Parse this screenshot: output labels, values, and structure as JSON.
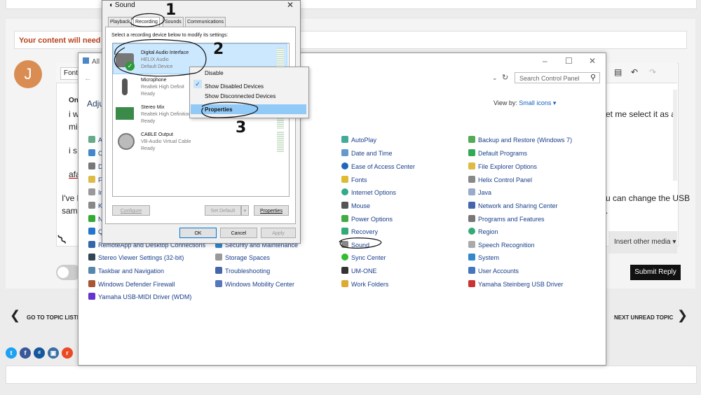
{
  "forum": {
    "warning": "Your content will need to",
    "avatar_letter": "J",
    "font_button": "Font",
    "text_on": "On",
    "text_i1": "i w",
    "text_mi": "mi",
    "text_is": "i s",
    "text_afa": "afa",
    "text_right1": "et me select it as a",
    "text_ive": "I've h",
    "text_samp": "samp",
    "text_right2": "u can change the USB",
    "text_right3": ".",
    "insert_media": "Insert other media ▾",
    "submit": "Submit Reply",
    "prev_topic": "GO TO TOPIC LISTI",
    "next_topic": "NEXT UNREAD TOPIC"
  },
  "control_panel": {
    "title": "All C",
    "search_placeholder": "Search Control Panel",
    "heading": "Adju",
    "view_by_label": "View by:",
    "view_by_value": "Small icons ▾",
    "col1": [
      "RemoteApp and Desktop Connections",
      "Storage Spaces",
      "Troubleshooting",
      "Windows Mobility Center"
    ],
    "col0": [
      "RemoteApp and Desktop Connections",
      "Stereo Viewer Settings (32-bit)",
      "Taskbar and Navigation",
      "Windows Defender Firewall",
      "Yamaha USB-MIDI Driver (WDM)"
    ],
    "col0_partial": [
      "Ad",
      "Co",
      "De",
      "Fi",
      "In",
      "Ke",
      "N",
      "Q"
    ],
    "col1_extra": [
      "Security and Maintenance",
      "Storage Spaces",
      "Troubleshooting",
      "Windows Mobility Center"
    ],
    "col1_partial": "r",
    "col2": [
      "AutoPlay",
      "Date and Time",
      "Ease of Access Center",
      "Fonts",
      "Internet Options",
      "Mouse",
      "Power Options",
      "Recovery",
      "Sound",
      "Sync Center",
      "UM-ONE",
      "Work Folders"
    ],
    "col3": [
      "Backup and Restore (Windows 7)",
      "Default Programs",
      "File Explorer Options",
      "Helix Control Panel",
      "Java",
      "Network and Sharing Center",
      "Programs and Features",
      "Region",
      "Speech Recognition",
      "System",
      "User Accounts",
      "Yamaha Steinberg USB Driver"
    ]
  },
  "sound_dialog": {
    "title": "Sound",
    "close": "✕",
    "tabs": [
      "Playback",
      "Recording",
      "Sounds",
      "Communications"
    ],
    "instruction": "Select a recording device below to modify its settings:",
    "devices": [
      {
        "name": "Digital Audio Interface",
        "sub1": "HELIX Audio",
        "sub2": "Default Device"
      },
      {
        "name": "Microphone",
        "sub1": "Realtek High Definit",
        "sub2": "Ready"
      },
      {
        "name": "Stereo Mix",
        "sub1": "Realtek High Definition",
        "sub2": "Ready"
      },
      {
        "name": "CABLE Output",
        "sub1": "VB-Audio Virtual Cable",
        "sub2": "Ready"
      }
    ],
    "configure": "Configure",
    "set_default": "Set Default",
    "properties": "Properties",
    "ok": "OK",
    "cancel": "Cancel",
    "apply": "Apply"
  },
  "context_menu": {
    "items": [
      "Disable",
      "Show Disabled Devices",
      "Show Disconnected Devices",
      "Properties"
    ]
  },
  "annotations": [
    "1",
    "2",
    "3"
  ],
  "colors": {
    "accent": "#0078d7",
    "warning": "#b8431e",
    "link": "#1a3f8a"
  }
}
